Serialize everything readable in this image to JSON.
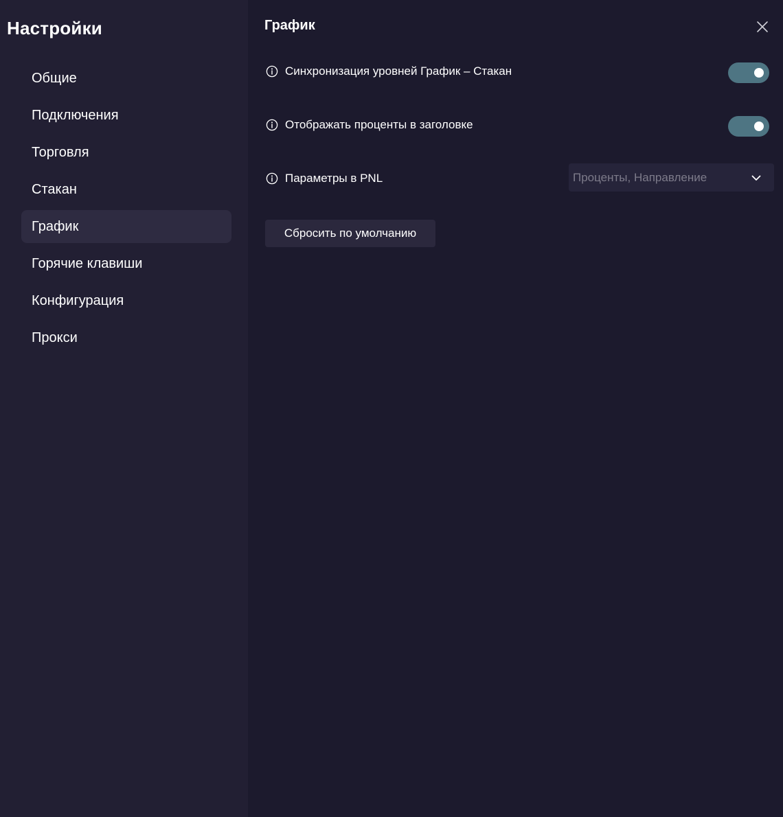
{
  "sidebar": {
    "title": "Настройки",
    "items": [
      {
        "label": "Общие",
        "active": false
      },
      {
        "label": "Подключения",
        "active": false
      },
      {
        "label": "Торговля",
        "active": false
      },
      {
        "label": "Стакан",
        "active": false
      },
      {
        "label": "График",
        "active": true
      },
      {
        "label": "Горячие клавиши",
        "active": false
      },
      {
        "label": "Конфигурация",
        "active": false
      },
      {
        "label": "Прокси",
        "active": false
      }
    ]
  },
  "main": {
    "title": "График",
    "settings": {
      "sync_levels": {
        "label": "Синхронизация уровней График – Стакан",
        "enabled": true
      },
      "show_percent": {
        "label": "Отображать проценты в заголовке",
        "enabled": true
      },
      "pnl_params": {
        "label": "Параметры в PNL",
        "value": "Проценты, Направление"
      }
    },
    "reset_label": "Сбросить по умолчанию"
  },
  "icons": {
    "close": "close-icon",
    "info": "info-icon",
    "chevron": "chevron-down-icon"
  },
  "colors": {
    "toggle_on": "#4e7583",
    "sidebar_bg": "#221f33",
    "main_bg": "#1c1a2d"
  }
}
